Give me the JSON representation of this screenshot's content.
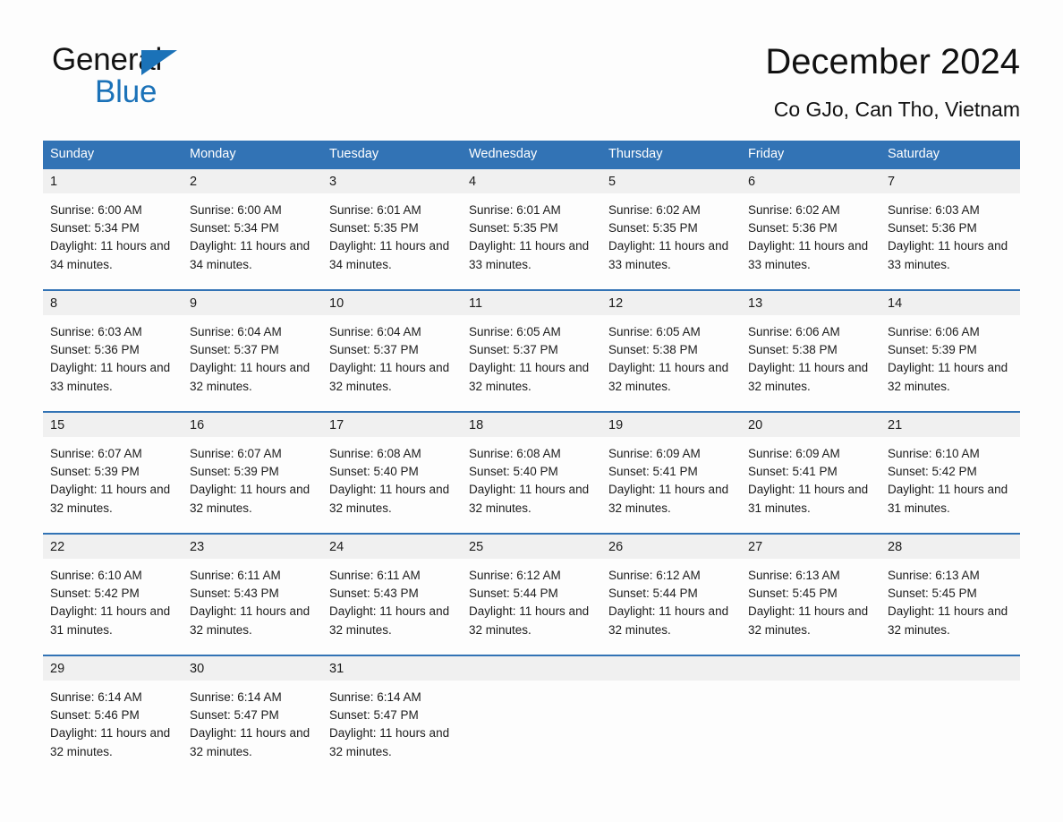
{
  "brand": {
    "name_line1": "General",
    "name_line2": "Blue",
    "triangle_icon": "triangle-icon",
    "accent_color": "#1b72b8"
  },
  "header": {
    "title": "December 2024",
    "subtitle": "Co GJo, Can Tho, Vietnam"
  },
  "theme": {
    "header_blue": "#3273b5",
    "date_band_gray": "#f0f0f0",
    "page_background": "#fdfdfd",
    "text_color": "#1c1c1c"
  },
  "calendar": {
    "weekday_headers": [
      "Sunday",
      "Monday",
      "Tuesday",
      "Wednesday",
      "Thursday",
      "Friday",
      "Saturday"
    ],
    "weeks": [
      {
        "days": [
          {
            "date": "1",
            "sunrise": "Sunrise: 6:00 AM",
            "sunset": "Sunset: 5:34 PM",
            "daylight": "Daylight: 11 hours and 34 minutes."
          },
          {
            "date": "2",
            "sunrise": "Sunrise: 6:00 AM",
            "sunset": "Sunset: 5:34 PM",
            "daylight": "Daylight: 11 hours and 34 minutes."
          },
          {
            "date": "3",
            "sunrise": "Sunrise: 6:01 AM",
            "sunset": "Sunset: 5:35 PM",
            "daylight": "Daylight: 11 hours and 34 minutes."
          },
          {
            "date": "4",
            "sunrise": "Sunrise: 6:01 AM",
            "sunset": "Sunset: 5:35 PM",
            "daylight": "Daylight: 11 hours and 33 minutes."
          },
          {
            "date": "5",
            "sunrise": "Sunrise: 6:02 AM",
            "sunset": "Sunset: 5:35 PM",
            "daylight": "Daylight: 11 hours and 33 minutes."
          },
          {
            "date": "6",
            "sunrise": "Sunrise: 6:02 AM",
            "sunset": "Sunset: 5:36 PM",
            "daylight": "Daylight: 11 hours and 33 minutes."
          },
          {
            "date": "7",
            "sunrise": "Sunrise: 6:03 AM",
            "sunset": "Sunset: 5:36 PM",
            "daylight": "Daylight: 11 hours and 33 minutes."
          }
        ]
      },
      {
        "days": [
          {
            "date": "8",
            "sunrise": "Sunrise: 6:03 AM",
            "sunset": "Sunset: 5:36 PM",
            "daylight": "Daylight: 11 hours and 33 minutes."
          },
          {
            "date": "9",
            "sunrise": "Sunrise: 6:04 AM",
            "sunset": "Sunset: 5:37 PM",
            "daylight": "Daylight: 11 hours and 32 minutes."
          },
          {
            "date": "10",
            "sunrise": "Sunrise: 6:04 AM",
            "sunset": "Sunset: 5:37 PM",
            "daylight": "Daylight: 11 hours and 32 minutes."
          },
          {
            "date": "11",
            "sunrise": "Sunrise: 6:05 AM",
            "sunset": "Sunset: 5:37 PM",
            "daylight": "Daylight: 11 hours and 32 minutes."
          },
          {
            "date": "12",
            "sunrise": "Sunrise: 6:05 AM",
            "sunset": "Sunset: 5:38 PM",
            "daylight": "Daylight: 11 hours and 32 minutes."
          },
          {
            "date": "13",
            "sunrise": "Sunrise: 6:06 AM",
            "sunset": "Sunset: 5:38 PM",
            "daylight": "Daylight: 11 hours and 32 minutes."
          },
          {
            "date": "14",
            "sunrise": "Sunrise: 6:06 AM",
            "sunset": "Sunset: 5:39 PM",
            "daylight": "Daylight: 11 hours and 32 minutes."
          }
        ]
      },
      {
        "days": [
          {
            "date": "15",
            "sunrise": "Sunrise: 6:07 AM",
            "sunset": "Sunset: 5:39 PM",
            "daylight": "Daylight: 11 hours and 32 minutes."
          },
          {
            "date": "16",
            "sunrise": "Sunrise: 6:07 AM",
            "sunset": "Sunset: 5:39 PM",
            "daylight": "Daylight: 11 hours and 32 minutes."
          },
          {
            "date": "17",
            "sunrise": "Sunrise: 6:08 AM",
            "sunset": "Sunset: 5:40 PM",
            "daylight": "Daylight: 11 hours and 32 minutes."
          },
          {
            "date": "18",
            "sunrise": "Sunrise: 6:08 AM",
            "sunset": "Sunset: 5:40 PM",
            "daylight": "Daylight: 11 hours and 32 minutes."
          },
          {
            "date": "19",
            "sunrise": "Sunrise: 6:09 AM",
            "sunset": "Sunset: 5:41 PM",
            "daylight": "Daylight: 11 hours and 32 minutes."
          },
          {
            "date": "20",
            "sunrise": "Sunrise: 6:09 AM",
            "sunset": "Sunset: 5:41 PM",
            "daylight": "Daylight: 11 hours and 31 minutes."
          },
          {
            "date": "21",
            "sunrise": "Sunrise: 6:10 AM",
            "sunset": "Sunset: 5:42 PM",
            "daylight": "Daylight: 11 hours and 31 minutes."
          }
        ]
      },
      {
        "days": [
          {
            "date": "22",
            "sunrise": "Sunrise: 6:10 AM",
            "sunset": "Sunset: 5:42 PM",
            "daylight": "Daylight: 11 hours and 31 minutes."
          },
          {
            "date": "23",
            "sunrise": "Sunrise: 6:11 AM",
            "sunset": "Sunset: 5:43 PM",
            "daylight": "Daylight: 11 hours and 32 minutes."
          },
          {
            "date": "24",
            "sunrise": "Sunrise: 6:11 AM",
            "sunset": "Sunset: 5:43 PM",
            "daylight": "Daylight: 11 hours and 32 minutes."
          },
          {
            "date": "25",
            "sunrise": "Sunrise: 6:12 AM",
            "sunset": "Sunset: 5:44 PM",
            "daylight": "Daylight: 11 hours and 32 minutes."
          },
          {
            "date": "26",
            "sunrise": "Sunrise: 6:12 AM",
            "sunset": "Sunset: 5:44 PM",
            "daylight": "Daylight: 11 hours and 32 minutes."
          },
          {
            "date": "27",
            "sunrise": "Sunrise: 6:13 AM",
            "sunset": "Sunset: 5:45 PM",
            "daylight": "Daylight: 11 hours and 32 minutes."
          },
          {
            "date": "28",
            "sunrise": "Sunrise: 6:13 AM",
            "sunset": "Sunset: 5:45 PM",
            "daylight": "Daylight: 11 hours and 32 minutes."
          }
        ]
      },
      {
        "days": [
          {
            "date": "29",
            "sunrise": "Sunrise: 6:14 AM",
            "sunset": "Sunset: 5:46 PM",
            "daylight": "Daylight: 11 hours and 32 minutes."
          },
          {
            "date": "30",
            "sunrise": "Sunrise: 6:14 AM",
            "sunset": "Sunset: 5:47 PM",
            "daylight": "Daylight: 11 hours and 32 minutes."
          },
          {
            "date": "31",
            "sunrise": "Sunrise: 6:14 AM",
            "sunset": "Sunset: 5:47 PM",
            "daylight": "Daylight: 11 hours and 32 minutes."
          },
          {
            "date": "",
            "sunrise": "",
            "sunset": "",
            "daylight": ""
          },
          {
            "date": "",
            "sunrise": "",
            "sunset": "",
            "daylight": ""
          },
          {
            "date": "",
            "sunrise": "",
            "sunset": "",
            "daylight": ""
          },
          {
            "date": "",
            "sunrise": "",
            "sunset": "",
            "daylight": ""
          }
        ]
      }
    ]
  }
}
